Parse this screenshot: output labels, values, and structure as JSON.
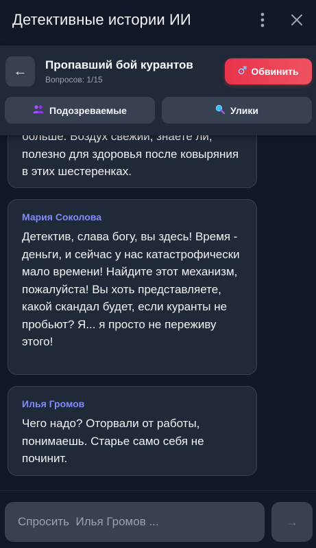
{
  "app": {
    "title": "Детективные истории ИИ"
  },
  "case": {
    "back_label": "←",
    "title": "Пропавший бой курантов",
    "questions": "Вопросов: 1/15",
    "accuse_label": "Обвинить",
    "accuse_icon": "male-sign-icon",
    "accuse_color": "#ef4444"
  },
  "tabs": {
    "suspects_label": "Подозреваемые",
    "suspects_icon": "people-icon",
    "clues_label": "Улики",
    "clues_icon": "magnifier-icon"
  },
  "messages": [
    {
      "author": "",
      "text": "больше. Воздух свежий, знаете ли, полезно для здоровья после ковыряния в этих шестеренках."
    },
    {
      "author": "Мария Соколова",
      "text": "Детектив, слава богу, вы здесь! Время - деньги, и сейчас у нас катастрофически мало времени! Найдите этот механизм, пожалуйста! Вы хоть представляете, какой скандал будет, если куранты не пробьют? Я... я просто не переживу этого!"
    },
    {
      "author": "Илья Громов",
      "text": "Чего надо? Оторвали от работы, понимаешь. Старье само себя не починит."
    }
  ],
  "composer": {
    "placeholder": "Спросить  Илья Громов ...",
    "send_label": "→"
  },
  "colors": {
    "background": "#111827",
    "panel": "#1f2937",
    "button": "#374151",
    "author": "#818cf8"
  }
}
